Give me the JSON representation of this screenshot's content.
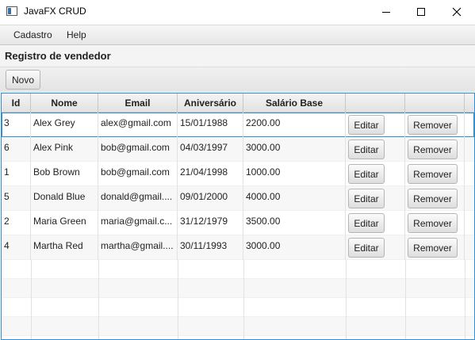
{
  "window": {
    "title": "JavaFX CRUD",
    "controls": {
      "minimize": "minimize-icon",
      "maximize": "maximize-icon",
      "close": "close-icon"
    }
  },
  "menu": {
    "items": [
      {
        "label": "Cadastro"
      },
      {
        "label": "Help"
      }
    ]
  },
  "header": {
    "title": "Registro de vendedor",
    "new_button": "Novo"
  },
  "table": {
    "columns": [
      "Id",
      "Nome",
      "Email",
      "Aniversário",
      "Salário Base",
      "",
      ""
    ],
    "edit_label": "Editar",
    "remove_label": "Remover",
    "rows": [
      {
        "id": "3",
        "nome": "Alex Grey",
        "email": "alex@gmail.com",
        "aniversario": "15/01/1988",
        "salario": "2200.00"
      },
      {
        "id": "6",
        "nome": "Alex Pink",
        "email": "bob@gmail.com",
        "aniversario": "04/03/1997",
        "salario": "3000.00"
      },
      {
        "id": "1",
        "nome": "Bob Brown",
        "email": "bob@gmail.com",
        "aniversario": "21/04/1998",
        "salario": "1000.00"
      },
      {
        "id": "5",
        "nome": "Donald Blue",
        "email": "donald@gmail....",
        "aniversario": "09/01/2000",
        "salario": "4000.00"
      },
      {
        "id": "2",
        "nome": "Maria Green",
        "email": "maria@gmail.c...",
        "aniversario": "31/12/1979",
        "salario": "3500.00"
      },
      {
        "id": "4",
        "nome": "Martha Red",
        "email": "martha@gmail....",
        "aniversario": "30/11/1993",
        "salario": "3000.00"
      }
    ]
  },
  "colors": {
    "selection_border": "#2f8fd6",
    "stripe": "#f7f7f7"
  }
}
